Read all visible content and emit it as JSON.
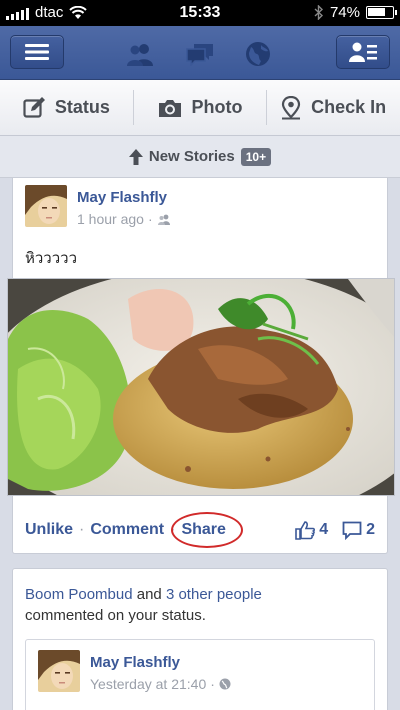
{
  "status_bar": {
    "carrier": "dtac",
    "time": "15:33",
    "battery_text": "74%",
    "battery_level": 0.74
  },
  "header": {
    "icons": [
      "menu-icon",
      "friend-requests-icon",
      "messages-icon",
      "notifications-globe-icon",
      "friends-list-icon"
    ]
  },
  "publisher": {
    "status": "Status",
    "photo": "Photo",
    "checkin": "Check In"
  },
  "new_stories": {
    "label": "New Stories",
    "badge": "10+"
  },
  "post": {
    "author": "May Flashfly",
    "time": "1 hour ago",
    "dot": "·",
    "text": "หิววววว",
    "actions": {
      "unlike": "Unlike",
      "comment": "Comment",
      "share": "Share",
      "sep": "·"
    },
    "likes": "4",
    "comments": "2"
  },
  "notification": {
    "actor": "Boom Poombud",
    "and": " and ",
    "others": "3 other people",
    "rest": "commented on your status.",
    "inner_author": "May Flashfly",
    "inner_time": "Yesterday at 21:40",
    "inner_dot": "·"
  },
  "colors": {
    "brand": "#3b5897",
    "highlight": "#d12a2a"
  }
}
